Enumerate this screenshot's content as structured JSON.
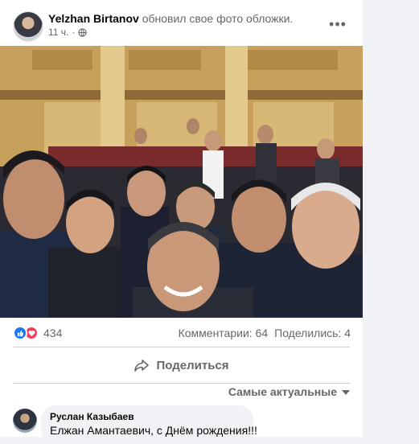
{
  "post": {
    "author": "Yelzhan Birtanov",
    "action": "обновил свое фото обложки.",
    "time": "11 ч.",
    "separator": "·",
    "privacy_icon": "globe-icon",
    "more_icon": "more-dots-icon",
    "more_label": "•••"
  },
  "photo": {
    "description_icon": "group-selfie-photo"
  },
  "engagement": {
    "reaction_icons": [
      "like-icon",
      "love-icon"
    ],
    "reactions_count": "434",
    "comments": "Комментарии: 64",
    "shares": "Поделились: 4"
  },
  "actions": {
    "share_label": "Поделиться",
    "share_icon": "share-arrow-icon"
  },
  "comments_section": {
    "sort_label": "Самые актуальные",
    "comment": {
      "author": "Руслан Казыбаев",
      "text": "Елжан Амантаевич, с Днём рождения!!!"
    }
  },
  "colors": {
    "like_blue": "#1877f2",
    "love_red": "#f33e58",
    "secondary_text": "#65676b",
    "page_bg": "#f0f2f5"
  }
}
